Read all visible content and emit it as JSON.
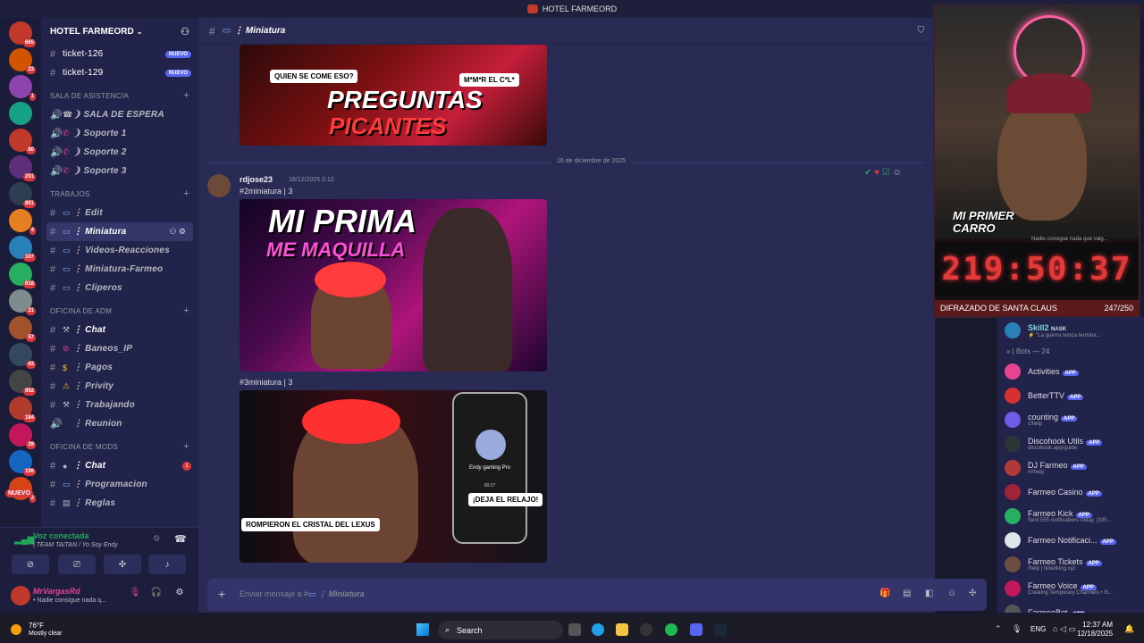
{
  "titlebar": {
    "title": "HOTEL FARMEORD"
  },
  "servers": [
    {
      "badge": "665",
      "color": "#c0392b"
    },
    {
      "badge": "23",
      "color": "#d35400"
    },
    {
      "badge": "1",
      "color": "#8e44ad"
    },
    {
      "badge": "",
      "color": "#16a085"
    },
    {
      "badge": "80",
      "color": "#c0392b"
    },
    {
      "badge": "201",
      "color": "#5d2f7a"
    },
    {
      "badge": "801",
      "color": "#2c3e50"
    },
    {
      "badge": "4",
      "color": "#e67e22"
    },
    {
      "badge": "107",
      "color": "#2980b9"
    },
    {
      "badge": "618",
      "color": "#27ae60"
    },
    {
      "badge": "21",
      "color": "#7f8c8d"
    },
    {
      "badge": "57",
      "color": "#a0522d"
    },
    {
      "badge": "43",
      "color": "#34495e"
    },
    {
      "badge": "952",
      "color": "#444"
    },
    {
      "badge": "184",
      "color": "#b03a2e"
    },
    {
      "badge": "29",
      "color": "#c2185b"
    },
    {
      "badge": "106",
      "color": "#1565c0"
    },
    {
      "badge": "2",
      "color": "#d84315"
    }
  ],
  "rail_new": "NUEVO",
  "sidebar": {
    "server_name": "HOTEL FARMEORD",
    "top_channels": [
      {
        "name": "ticket-126",
        "tag": "NUEVO"
      },
      {
        "name": "ticket-129",
        "tag": "NUEVO"
      }
    ],
    "cat_asistencia": "SALA DE ASISTENCIA",
    "asistencia": [
      {
        "emoji": "☎",
        "name": "❩ SALA DE ESPERA"
      },
      {
        "emoji": "",
        "name": "❩ Soporte 1"
      },
      {
        "emoji": "",
        "name": "❩ Soporte 2"
      },
      {
        "emoji": "",
        "name": "❩ Soporte 3"
      }
    ],
    "cat_trabajos": "TRABAJOS",
    "trabajos": [
      {
        "name": "⋮ Edit"
      },
      {
        "name": "⋮ Miniatura"
      },
      {
        "name": "⋮ Videos-Reacciones"
      },
      {
        "name": "⋮ Miniatura-Farmeo"
      },
      {
        "name": "⋮ Cliperos"
      }
    ],
    "cat_adm": "OFICINA DE ADM",
    "adm": [
      {
        "emoji": "⚒",
        "name": "⋮ Chat"
      },
      {
        "emoji": "⊘",
        "name": "⋮ Baneos_IP"
      },
      {
        "emoji": "$",
        "name": "⋮ Pagos"
      },
      {
        "emoji": "⚠",
        "name": "⋮ Privity"
      },
      {
        "emoji": "⚒",
        "name": "⋮ Trabajando"
      },
      {
        "emoji": "",
        "name": "⋮ Reunion"
      }
    ],
    "cat_mods": "OFICINA DE MODS",
    "mods": [
      {
        "emoji": "●",
        "name": "⋮ Chat",
        "count": "1"
      },
      {
        "emoji": "▭",
        "name": "⋮ Programacion"
      },
      {
        "emoji": "▤",
        "name": "⋮ Reglas"
      }
    ]
  },
  "voice": {
    "status": "Voz conectada",
    "channel": "| TEAM TAITAN / Yo Soy Endy"
  },
  "user": {
    "name": "MrVargasRd",
    "status": "• Nadie consigue nada q..."
  },
  "chat": {
    "channel": "⋮ Miniatura",
    "thumb1_left": "QUIEN SE COME ESO?",
    "thumb1_right": "M*M*R EL C*L*",
    "thumb1_title1": "PREGUNTAS",
    "thumb1_title2": "PICANTES",
    "date": "16 de diciembre de 2025",
    "author": "rdjose23",
    "time": "16/12/2025 2:12",
    "line1": "#2miniatura | 3",
    "thumb2_title1": "MI PRIMA",
    "thumb2_title2": "ME MAQUILLA",
    "line2": "#3miniatura | 3",
    "thumb3_caption": "ROMPIERON EL CRISTAL DEL LEXUS",
    "thumb3_phone": "Endy gaming Pro",
    "thumb3_phone_time": "00:27",
    "thumb3_bubble": "¡DEJA EL RELAJO!",
    "placeholder_prefix": "Enviar mensaje a #",
    "placeholder_channel": "⋮ Miniatura"
  },
  "overlay": {
    "cam_caption1": "MI PRIMER",
    "cam_caption2": "CARRO",
    "cam_sub": "Nadie consigue nada que valg...",
    "timer": "219:50:37",
    "goal_label": "DIFRAZADO DE SANTA CLAUS",
    "goal_count": "247/250"
  },
  "members": {
    "top_name": "Skill2",
    "top_badge": "NASK",
    "top_sub": "⚡ \"La guerra nunca termina...",
    "bots_header": "» | Bots — 24",
    "bots": [
      {
        "name": "Activities",
        "sub": "",
        "color": "#e84393"
      },
      {
        "name": "BetterTTV",
        "sub": "",
        "color": "#d63031"
      },
      {
        "name": "counting",
        "sub": "c!help",
        "color": "#6c5ce7"
      },
      {
        "name": "Discohook Utils",
        "sub": "discohook.app/guide",
        "color": "#2d3436"
      },
      {
        "name": "DJ Farmeo",
        "sub": "m!help",
        "color": "#b33939"
      },
      {
        "name": "Farmeo Casino",
        "sub": "",
        "color": "#a0233a"
      },
      {
        "name": "Farmeo Kick",
        "sub": "Sent 555 notifications today. (335...",
        "color": "#27ae60"
      },
      {
        "name": "Farmeo Notificaci...",
        "sub": "",
        "color": "#dfe6e9"
      },
      {
        "name": "Farmeo Tickets",
        "sub": "/help | ticketking.xyz",
        "color": "#6d4c41"
      },
      {
        "name": "Farmeo Voice",
        "sub": "Creating Temporary Channels • /h...",
        "color": "#c2185b"
      },
      {
        "name": "FarmeoBot",
        "sub": "",
        "color": "#555"
      }
    ],
    "app_tag": "APP"
  },
  "taskbar": {
    "temp": "76°F",
    "weather": "Mostly clear",
    "search": "Search",
    "lang": "ENG",
    "time": "12:37 AM",
    "date": "12/18/2025"
  }
}
